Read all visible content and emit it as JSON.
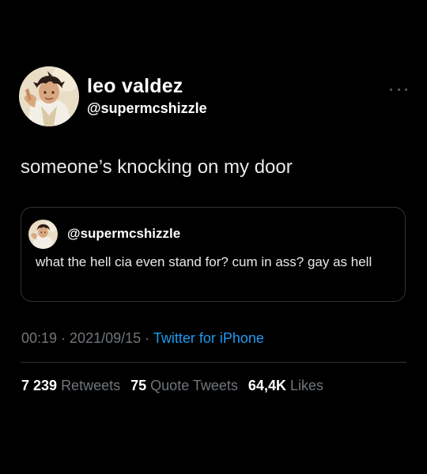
{
  "author": {
    "display_name": "leo valdez",
    "handle": "@supermcshizzle"
  },
  "tweet": {
    "text": "someone’s knocking on my door"
  },
  "quoted_tweet": {
    "handle": "@supermcshizzle",
    "text": "what the hell cia even stand for? cum in ass? gay as hell"
  },
  "meta": {
    "time": "00:19",
    "sep1": " · ",
    "date": "2021/09/15",
    "sep2": " · ",
    "source": "Twitter for iPhone"
  },
  "stats": {
    "retweets_count": "7 239",
    "retweets_label": "Retweets",
    "quotes_count": "75",
    "quotes_label": "Quote Tweets",
    "likes_count": "64,4K",
    "likes_label": "Likes"
  },
  "icons": {
    "more": "more-horizontal-icon"
  },
  "colors": {
    "background": "#000000",
    "text": "#e7e9ea",
    "muted": "#71767b",
    "link": "#1d9bf0",
    "border": "#2f3336"
  }
}
